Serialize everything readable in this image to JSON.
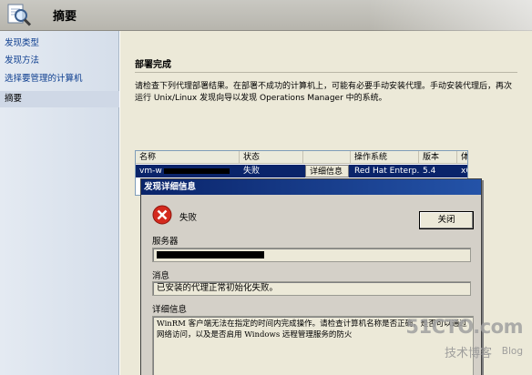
{
  "header": {
    "title": "摘要",
    "icon": "search-magnifier-icon"
  },
  "nav": {
    "items": [
      {
        "label": "发现类型",
        "selected": false
      },
      {
        "label": "发现方法",
        "selected": false
      },
      {
        "label": "选择要管理的计算机",
        "selected": false
      },
      {
        "label": "摘要",
        "selected": true
      }
    ]
  },
  "main": {
    "heading": "部署完成",
    "instructions": "请检查下列代理部署结果。在部署不成功的计算机上，可能有必要手动安装代理。手动安装代理后，再次运行 Unix/Linux 发现向导以发现 Operations Manager 中的系统。"
  },
  "results": {
    "columns": [
      "名称",
      "状态",
      "",
      "操作系统",
      "版本",
      "体"
    ],
    "row": {
      "name": "vm-w",
      "status": "失败",
      "details_label": "详细信息",
      "os": "Red Hat Enterp...",
      "version": "5.4",
      "arch": "x6"
    }
  },
  "dialog": {
    "title": "发现详细信息",
    "status": "失败",
    "close_label": "关闭",
    "server_label": "服务器",
    "server_value": "",
    "message_label": "消息",
    "message_value": "已安装的代理正常初始化失败。",
    "details_label": "详细信息",
    "details_value": "WinRM 客户端无法在指定的时间内完成操作。请检查计算机名称是否正确，是否可以通过网络访问，以及是否启用 Windows 远程管理服务的防火"
  },
  "watermark": {
    "logo": "51CTO.com",
    "subtitle": "技术博客",
    "blog": "Blog"
  },
  "colors": {
    "selection": "#0a246a",
    "dialog_bg": "#d4d0c8",
    "nav_link": "#0c3d8f",
    "error": "#d42a1e"
  }
}
